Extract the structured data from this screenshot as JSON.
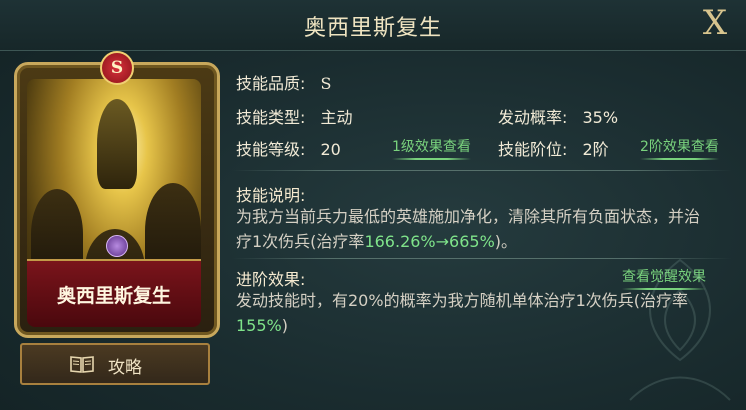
{
  "header": {
    "title": "奥西里斯复生",
    "close_label": "X"
  },
  "card": {
    "grade_badge": "S",
    "name": "奥西里斯复生"
  },
  "guide_button": {
    "label": "攻略",
    "icon": "book-icon"
  },
  "stats": {
    "quality": {
      "label": "技能品质:",
      "value": "S"
    },
    "type": {
      "label": "技能类型:",
      "value": "主动"
    },
    "trigger_rate": {
      "label": "发动概率:",
      "value": "35%"
    },
    "level": {
      "label": "技能等级:",
      "value": "20",
      "link": "1级效果查看"
    },
    "rank": {
      "label": "技能阶位:",
      "value": "2阶",
      "link": "2阶效果查看"
    }
  },
  "description": {
    "title": "技能说明:",
    "text_part1": "为我方当前兵力最低的英雄施加净化，清除其所有负面状态，并治疗1次伤兵(治疗率",
    "highlight": "166.26%→665%",
    "text_part2": ")。"
  },
  "advanced": {
    "title": "进阶效果:",
    "link": "查看觉醒效果",
    "text_part1": "发动技能时，有20%的概率为我方随机单体治疗1次伤兵(治疗率",
    "highlight": "155%",
    "text_part2": ")"
  },
  "colors": {
    "accent_green": "#7fe38a",
    "gold": "#c8a85c",
    "panel": "#1a2c2f"
  }
}
